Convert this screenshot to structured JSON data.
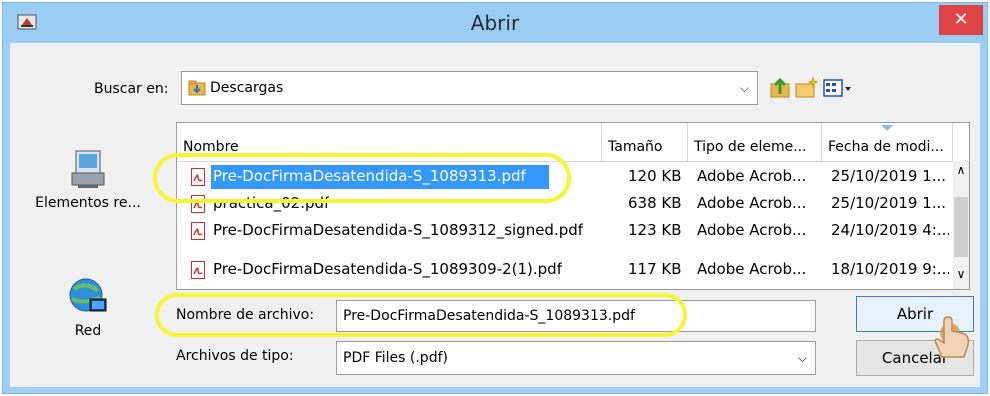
{
  "window": {
    "title": "Abrir",
    "close_glyph": "✕"
  },
  "lookin": {
    "label": "Buscar en:",
    "value": "Descargas",
    "chevron": "⌵"
  },
  "toolbar": {
    "icons": [
      "up-folder-icon",
      "new-folder-icon",
      "view-menu-icon"
    ]
  },
  "places": [
    {
      "label": "Elementos re...",
      "icon": "recent-items-icon"
    },
    {
      "label": "Red",
      "icon": "network-icon"
    }
  ],
  "columns": [
    "Nombre",
    "Tamaño",
    "Tipo de eleme...",
    "Fecha de modi..."
  ],
  "files": [
    {
      "name": "Pre-DocFirmaDesatendida-S_1089313.pdf",
      "size": "120 KB",
      "type": "Adobe Acrob...",
      "date": "25/10/2019 1..."
    },
    {
      "name": "practica_02.pdf",
      "size": "638 KB",
      "type": "Adobe Acrob...",
      "date": "25/10/2019 1..."
    },
    {
      "name": "Pre-DocFirmaDesatendida-S_1089312_signed.pdf",
      "size": "123 KB",
      "type": "Adobe Acrob...",
      "date": "24/10/2019 4:..."
    },
    {
      "name": "Pre-DocFirmaDesatendida-S_1089309-2(1).pdf",
      "size": "117 KB",
      "type": "Adobe Acrob...",
      "date": "18/10/2019 9:..."
    }
  ],
  "scroll": {
    "up": "∧",
    "down": "∨"
  },
  "filename": {
    "label": "Nombre de archivo:",
    "value": "Pre-DocFirmaDesatendida-S_1089313.pdf"
  },
  "filetype": {
    "label": "Archivos de tipo:",
    "value": "PDF Files (.pdf)",
    "chevron": "⌵"
  },
  "buttons": {
    "open": "Abrir",
    "cancel": "Cancelar"
  },
  "colors": {
    "title_bar": "#99cdf4",
    "close": "#e04343",
    "selection": "#3399ff",
    "highlight": "#f5f531"
  }
}
